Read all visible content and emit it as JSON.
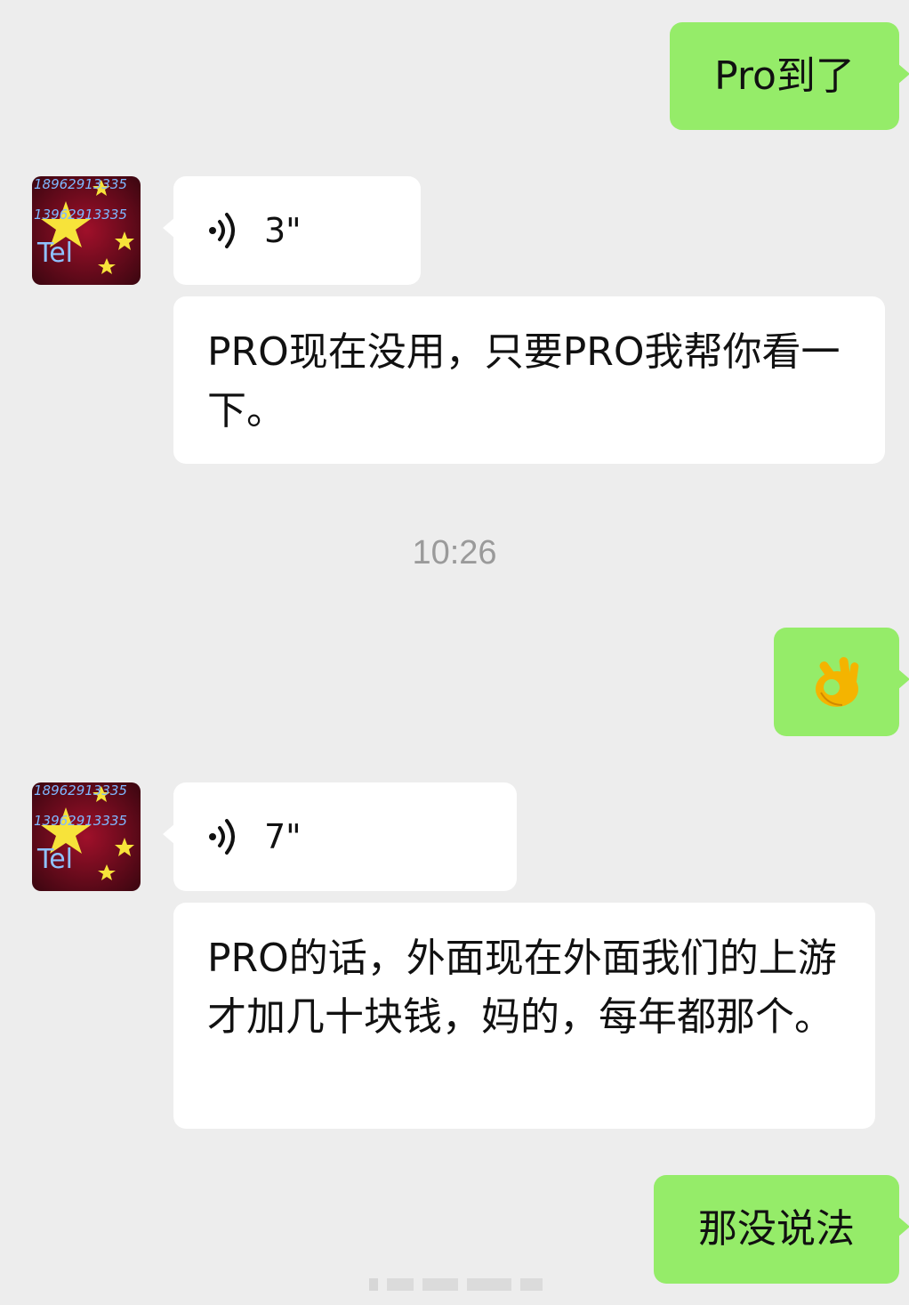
{
  "messages": {
    "m1": {
      "text": "Pro到了"
    },
    "m2": {
      "duration": "3\""
    },
    "m3": {
      "text": "PRO现在没用，只要PRO我帮你看一下。"
    },
    "time": "10:26",
    "m4": {
      "emoji": "👌"
    },
    "m5": {
      "duration": "7\""
    },
    "m6": {
      "text": "PRO的话，外面现在外面我们的上游才加几十块钱，妈的，每年都那个。"
    },
    "m7": {
      "text": "那没说法"
    }
  },
  "avatar": {
    "text_line1": "18962913335",
    "text_line2": "13962913335",
    "text_line3": "Tel"
  },
  "colors": {
    "background": "#ededed",
    "outgoing_bubble": "#95ec69",
    "incoming_bubble": "#ffffff",
    "timestamp": "#9a9a9a"
  }
}
